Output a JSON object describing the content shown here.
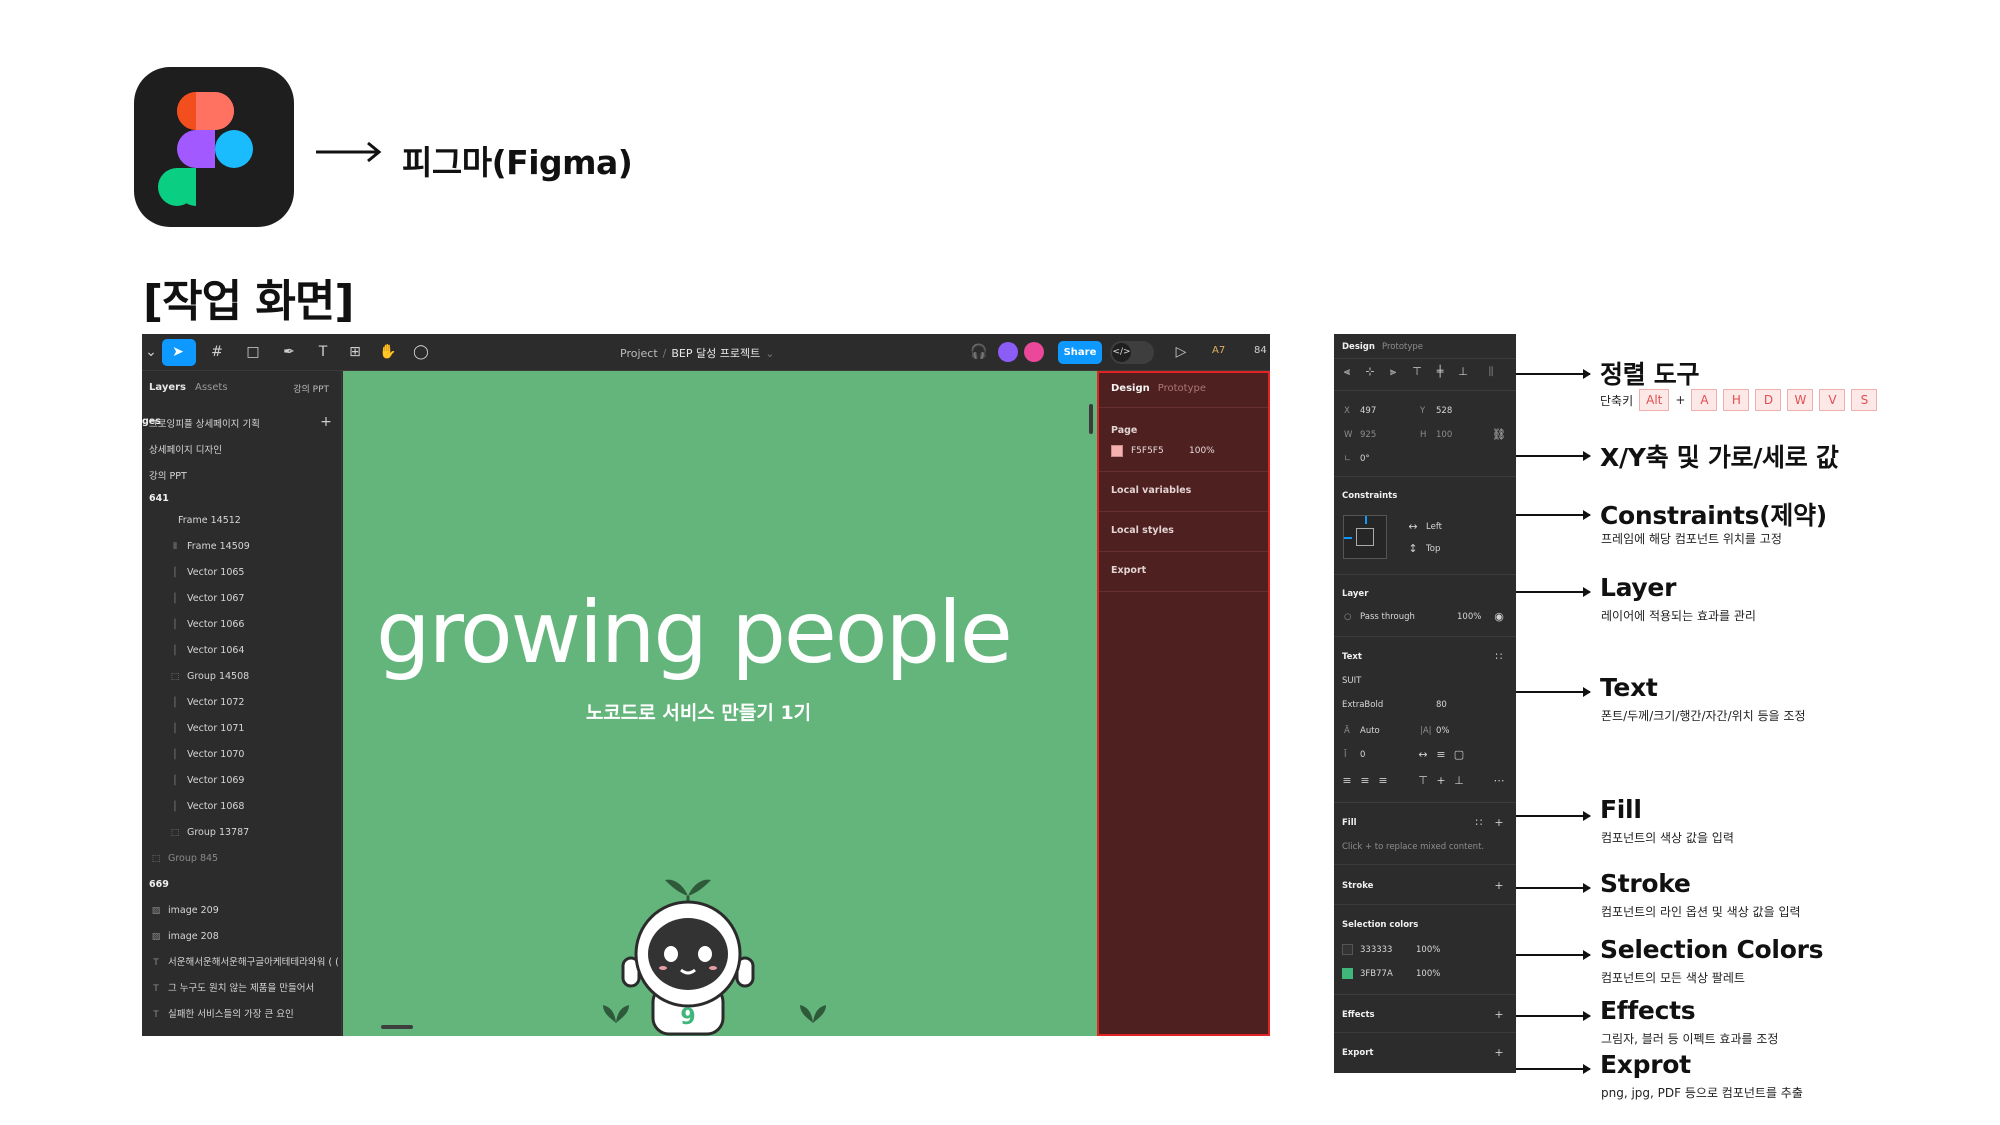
{
  "header": {
    "app_title": "피그마(Figma)",
    "section_title": "[작업 화면]"
  },
  "figma": {
    "toolbar": {
      "breadcrumb_project": "Project",
      "breadcrumb_file": "BEP 달성 프로젝트",
      "share_label": "Share",
      "zoom_label": "A7",
      "zoom_value": "84"
    },
    "layers_panel": {
      "tab_layers": "Layers",
      "tab_assets": "Assets",
      "page_name": "강의 PPT",
      "pages_label": "ges",
      "rows": [
        {
          "label": "그로잉피플 상세페이지 기획",
          "kind": "page"
        },
        {
          "label": "상세페이지 디자인",
          "kind": "page"
        },
        {
          "label": "강의 PPT",
          "kind": "page"
        },
        {
          "label": "641",
          "kind": "frame"
        },
        {
          "label": "Frame 14512",
          "kind": "frame-cut"
        },
        {
          "label": "Frame 14509",
          "kind": "layer"
        },
        {
          "label": "Vector 1065",
          "kind": "vector"
        },
        {
          "label": "Vector 1067",
          "kind": "vector"
        },
        {
          "label": "Vector 1066",
          "kind": "vector"
        },
        {
          "label": "Vector 1064",
          "kind": "vector"
        },
        {
          "label": "Group 14508",
          "kind": "group"
        },
        {
          "label": "Vector 1072",
          "kind": "vector"
        },
        {
          "label": "Vector 1071",
          "kind": "vector"
        },
        {
          "label": "Vector 1070",
          "kind": "vector"
        },
        {
          "label": "Vector 1069",
          "kind": "vector"
        },
        {
          "label": "Vector 1068",
          "kind": "vector"
        },
        {
          "label": "Group 13787",
          "kind": "group"
        },
        {
          "label": "Group 845",
          "kind": "group-dim"
        },
        {
          "label": "669",
          "kind": "frame"
        },
        {
          "label": "image 209",
          "kind": "image"
        },
        {
          "label": "image 208",
          "kind": "image"
        },
        {
          "label": "서운해서운해서운해구글아케테테라와워 ( ( ...",
          "kind": "text"
        },
        {
          "label": "그 누구도 원치 않는 제품을 만들어서",
          "kind": "text"
        },
        {
          "label": "실패한 서비스들의 가장 큰 요인",
          "kind": "text"
        }
      ]
    },
    "canvas": {
      "headline": "growing people",
      "subtitle": "노코드로 서비스 만들기 1기",
      "mascot_number": "9",
      "background": "#64b57c"
    },
    "design_panel": {
      "tab_design": "Design",
      "tab_prototype": "Prototype",
      "page_label": "Page",
      "page_color": "F5F5F5",
      "page_opacity": "100%",
      "local_variables": "Local variables",
      "local_styles": "Local styles",
      "export": "Export"
    }
  },
  "design_panel_detail": {
    "tab_design": "Design",
    "tab_prototype": "Prototype",
    "x_label": "X",
    "x_value": "497",
    "y_label": "Y",
    "y_value": "528",
    "w_label": "W",
    "w_value": "925",
    "h_label": "H",
    "h_value": "100",
    "rotation": "0°",
    "constraints_label": "Constraints",
    "constraint_h": "Left",
    "constraint_v": "Top",
    "layer_label": "Layer",
    "blend_mode": "Pass through",
    "layer_opacity": "100%",
    "text_label": "Text",
    "font_family": "SUIT",
    "font_weight": "ExtraBold",
    "font_size": "80",
    "line_height": "Auto",
    "letter_spacing": "0%",
    "paragraph_spacing": "0",
    "fill_label": "Fill",
    "fill_hint": "Click + to replace mixed content.",
    "stroke_label": "Stroke",
    "selection_colors_label": "Selection colors",
    "selection_colors": [
      {
        "hex": "333333",
        "opacity": "100%",
        "swatch": "#333333"
      },
      {
        "hex": "3FB77A",
        "opacity": "100%",
        "swatch": "#3FB77A"
      }
    ],
    "effects_label": "Effects",
    "export_label": "Export"
  },
  "annotations": [
    {
      "title": "정렬 도구",
      "desc": ""
    },
    {
      "title": "X/Y축 및 가로/세로 값",
      "desc": ""
    },
    {
      "title": "Constraints(제약)",
      "desc": "프레임에 해당 컴포넌트 위치를 고정"
    },
    {
      "title": "Layer",
      "desc": "레이어에 적용되는 효과를 관리"
    },
    {
      "title": "Text",
      "desc": "폰트/두께/크기/행간/자간/위치 등을 조정"
    },
    {
      "title": "Fill",
      "desc": "컴포넌트의 색상 값을 입력"
    },
    {
      "title": "Stroke",
      "desc": "컴포넌트의 라인 옵션 및 색상 값을 입력"
    },
    {
      "title": "Selection Colors",
      "desc": "컴포넌트의 모든 색상 팔레트"
    },
    {
      "title": "Effects",
      "desc": "그림자, 블러 등 이펙트 효과를 조정"
    },
    {
      "title": "Exprot",
      "desc": "png, jpg, PDF 등으로 컴포넌트를 추출"
    }
  ],
  "shortcut": {
    "label": "단축키",
    "first_key": "Alt",
    "plus": "+",
    "keys": [
      "A",
      "H",
      "D",
      "W",
      "V",
      "S"
    ]
  }
}
